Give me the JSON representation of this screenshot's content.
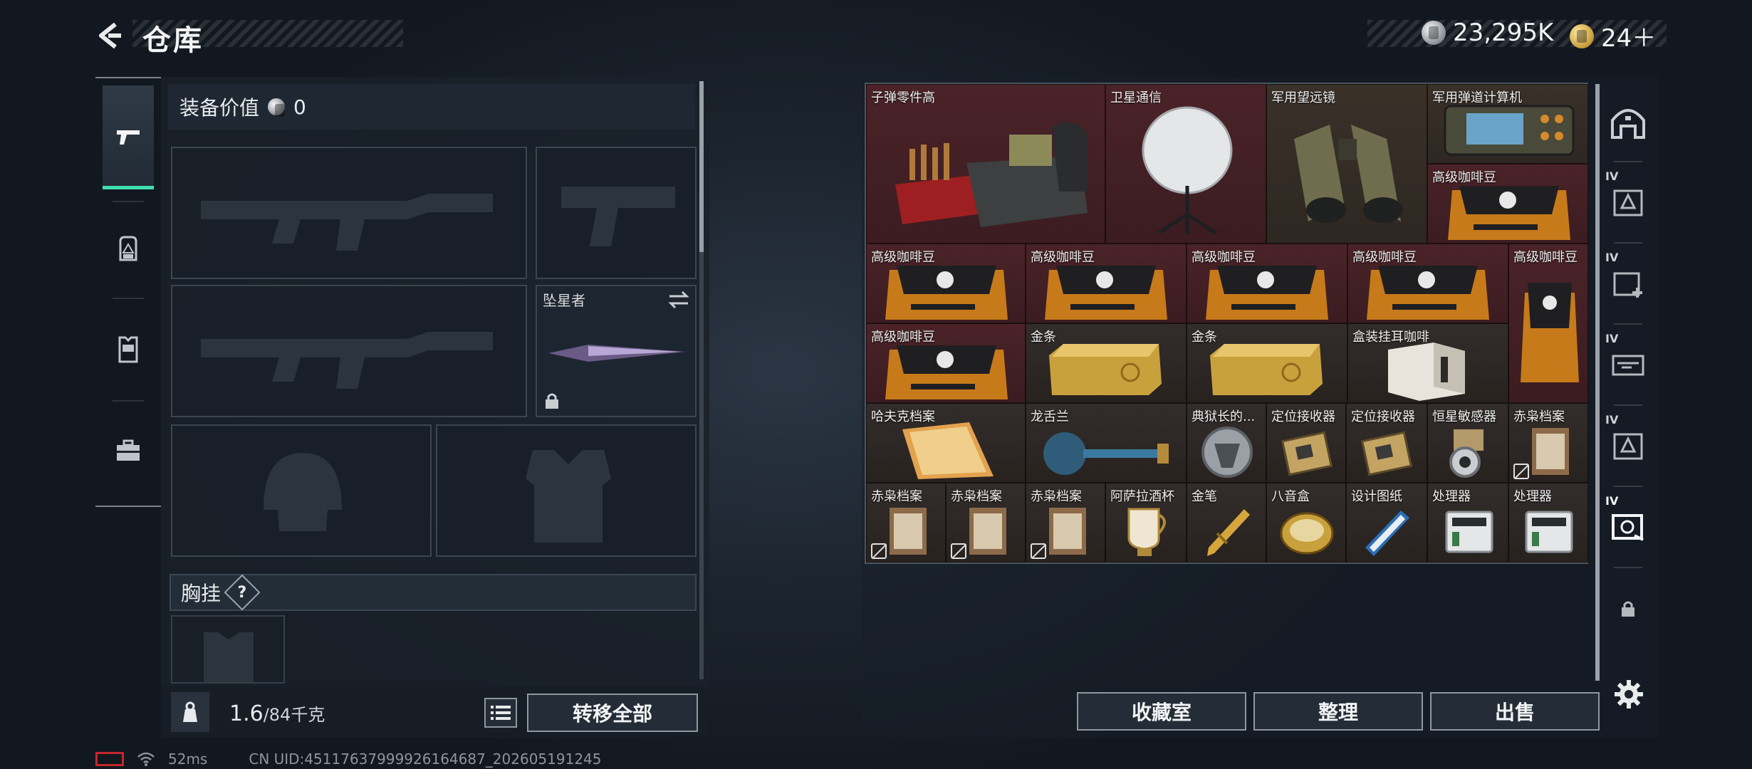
{
  "header": {
    "title": "仓库"
  },
  "currency": [
    {
      "type": "coin",
      "value": "23,295K"
    },
    {
      "type": "ticket",
      "value": "24＋"
    }
  ],
  "equipment": {
    "label": "装备价值",
    "value": "0",
    "melee_label": "坠星者",
    "chest_label": "胸挂",
    "chest_help": "?",
    "weight_current": "1.6",
    "weight_max": "/84千克",
    "transfer_all": "转移全部"
  },
  "storage": {
    "items": [
      {
        "name": "子弹零件高"
      },
      {
        "name": "卫星通信"
      },
      {
        "name": "军用望远镜"
      },
      {
        "name": "军用弹道计算机"
      },
      {
        "name": "高级咖啡豆"
      },
      {
        "name": "高级咖啡豆"
      },
      {
        "name": "高级咖啡豆"
      },
      {
        "name": "高级咖啡豆"
      },
      {
        "name": "高级咖啡豆"
      },
      {
        "name": "高级咖啡豆"
      },
      {
        "name": "高级咖啡豆"
      },
      {
        "name": "金条"
      },
      {
        "name": "金条"
      },
      {
        "name": "盒装挂耳咖啡"
      },
      {
        "name": "哈夫克档案"
      },
      {
        "name": "龙舌兰"
      },
      {
        "name": "典狱长的..."
      },
      {
        "name": "定位接收器"
      },
      {
        "name": "定位接收器"
      },
      {
        "name": "恒星敏感器"
      },
      {
        "name": "赤枭档案"
      },
      {
        "name": "赤枭档案"
      },
      {
        "name": "赤枭档案"
      },
      {
        "name": "赤枭档案"
      },
      {
        "name": "阿萨拉酒杯"
      },
      {
        "name": "金笔"
      },
      {
        "name": "八音盒"
      },
      {
        "name": "设计图纸"
      },
      {
        "name": "处理器"
      },
      {
        "name": "处理器"
      }
    ],
    "buttons": {
      "collection": "收藏室",
      "sort": "整理",
      "sell": "出售"
    }
  },
  "right_tabs": [
    "IV",
    "IV",
    "IV",
    "IV",
    "IV"
  ],
  "status": {
    "ping": "52ms",
    "uid": "CN UID:45117637999926164687_202605191245"
  },
  "colors": {
    "accent": "#3fe0b0",
    "rare_red": "#4a2328",
    "brown": "#3a3129"
  }
}
